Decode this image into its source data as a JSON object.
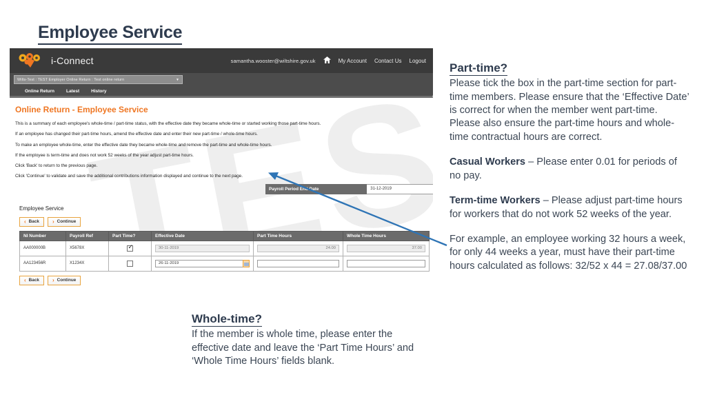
{
  "slide": {
    "title": "Employee Service"
  },
  "app": {
    "brand": "i-Connect",
    "logo_icon": "iconnect-logo-icon",
    "header": {
      "email": "samantha.wooster@wiltshire.gov.uk",
      "home_icon": "home-icon",
      "links": [
        "My Account",
        "Contact Us",
        "Logout"
      ]
    },
    "org_select": {
      "value": "Wilts-Test : TEST Employer Online Return : Test online return",
      "caret_icon": "chevron-down-icon"
    },
    "tabs": [
      "Online Return",
      "Latest",
      "History"
    ],
    "watermark": "TEST",
    "page_heading": "Online Return - Employee Service",
    "instructions": [
      "This is a summary of each employee's whole-time / part-time status, with the effective date they became whole-time or started working those part-time hours.",
      "If an employee has changed their part-time hours, amend the effective date and enter their new part-time / whole-time hours.",
      "To make an employee whole-time, enter the effective date they became whole-time and remove the part-time and whole-time hours.",
      "If the employee is term-time and does not work 52 weeks of the year adjust part-time hours.",
      "Click 'Back' to return to the previous page.",
      "Click 'Continue' to validate and save the additional contributions information displayed and continue to the next page."
    ],
    "payroll_period": {
      "label": "Payroll Period End Date",
      "value": "31-12-2019"
    },
    "section_title": "Employee Service",
    "buttons": {
      "back": "Back",
      "continue": "Continue",
      "back_icon": "chevron-left-icon",
      "continue_icon": "chevron-right-icon"
    },
    "table": {
      "headers": [
        "NI Number",
        "Payroll Ref",
        "Part Time?",
        "Effective Date",
        "Part Time Hours",
        "Whole Time Hours"
      ],
      "rows": [
        {
          "ni_number": "AA000000B",
          "payroll_ref": "X5678X",
          "part_time": true,
          "effective_date": "30-11-2019",
          "part_time_hours": "24.00",
          "whole_time_hours": "37.00",
          "editable": false
        },
        {
          "ni_number": "AA123456R",
          "payroll_ref": "X1234X",
          "part_time": false,
          "effective_date": "26-11-2019",
          "part_time_hours": "",
          "whole_time_hours": "",
          "editable": true
        }
      ]
    }
  },
  "notes": {
    "part_time": {
      "heading": "Part-time?",
      "body": "Please tick the box in the part-time section for part-time members. Please ensure that the ‘Effective Date’ is correct for when the member went part-time. Please also ensure the part-time hours and whole-time contractual hours are correct."
    },
    "casual": {
      "label": "Casual Workers",
      "body": " – Please enter 0.01 for periods of no pay."
    },
    "term_time": {
      "label": "Term-time Workers",
      "body": " – Please adjust part-time hours for workers that do not work 52 weeks of the year."
    },
    "example": "For example, an employee working 32 hours a week, for only 44 weeks a year, must have their part-time hours calculated as follows: 32/52 x 44 = 27.08/37.00",
    "whole_time": {
      "heading": "Whole-time?",
      "body": "If the member is whole time, please enter the effective date and leave the ‘Part Time Hours’ and ‘Whole Time Hours’ fields blank."
    }
  }
}
